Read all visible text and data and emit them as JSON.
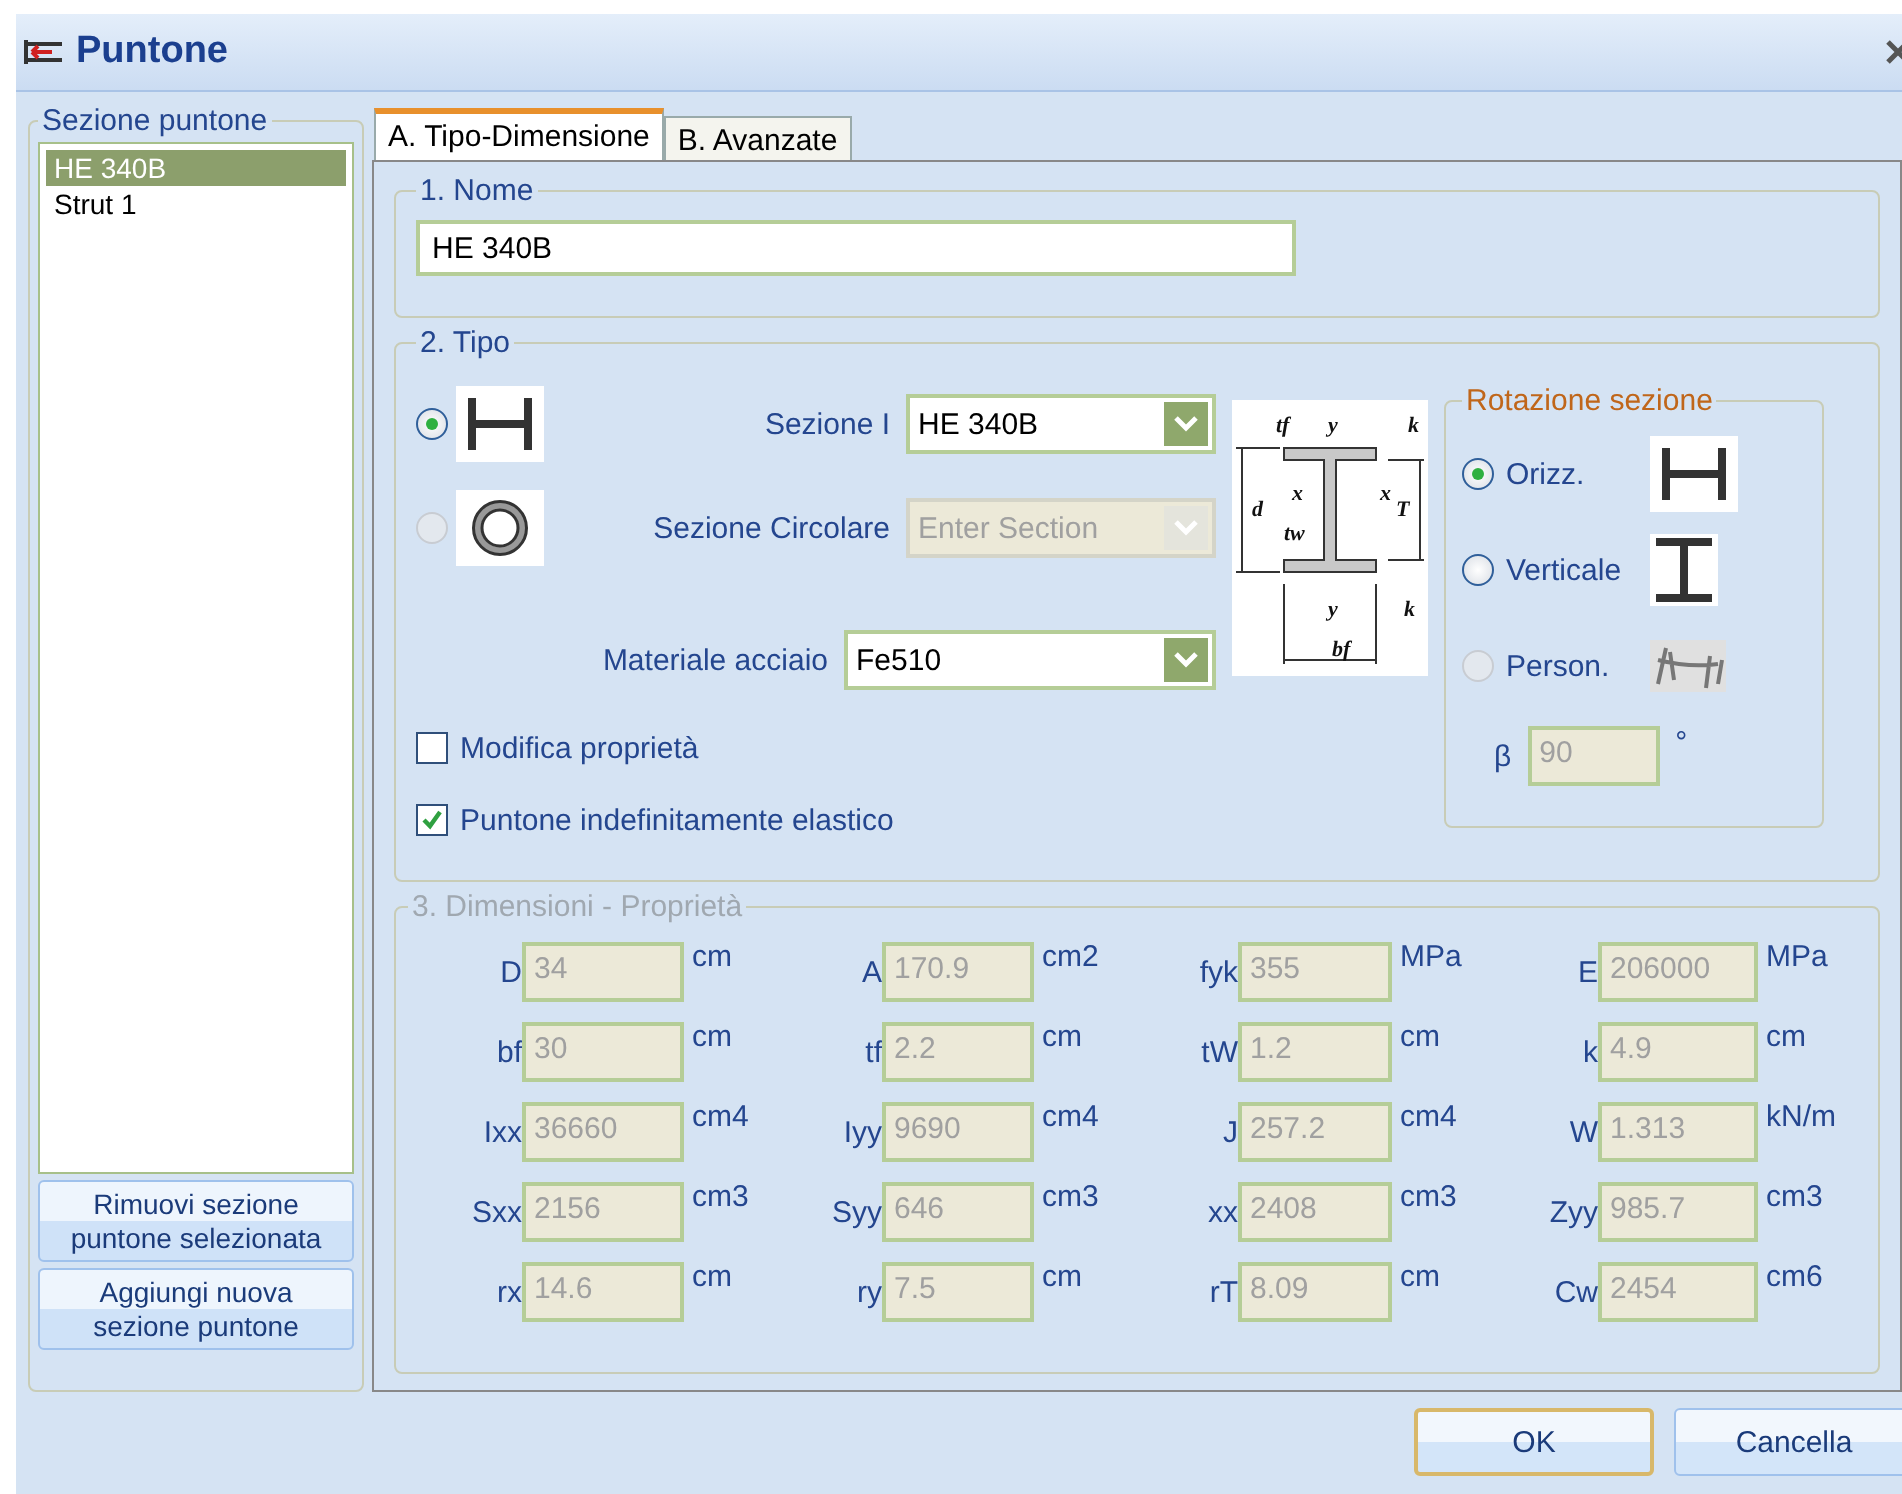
{
  "window": {
    "title": "Puntone"
  },
  "sidebar": {
    "title": "Sezione puntone",
    "items": [
      {
        "label": "HE 340B",
        "selected": true
      },
      {
        "label": "Strut 1",
        "selected": false
      }
    ],
    "buttons": [
      "Rimuovi sezione puntone selezionata",
      "Aggiungi nuova sezione puntone"
    ]
  },
  "tabs": [
    {
      "label": "A. Tipo-Dimensione",
      "selected": true
    },
    {
      "label": "B. Avanzate",
      "selected": false
    }
  ],
  "nome": {
    "title": "1. Nome",
    "value": "HE 340B"
  },
  "tipo": {
    "title": "2. Tipo",
    "options": [
      {
        "kind": "i_section",
        "selected": true,
        "label": "Sezione I",
        "value": "HE 340B",
        "disabled": false
      },
      {
        "kind": "circular",
        "selected": false,
        "label": "Sezione Circolare",
        "placeholder": "Enter Section",
        "disabled": true
      }
    ],
    "material": {
      "label": "Materiale acciaio",
      "value": "Fe510"
    },
    "checkboxes": [
      {
        "label": "Modifica proprietà",
        "checked": false
      },
      {
        "label": "Puntone indefinitamente elastico",
        "checked": true
      }
    ],
    "diagram_labels": [
      "tf",
      "y",
      "k",
      "d",
      "x",
      "x",
      "T",
      "tw",
      "y",
      "k",
      "bf"
    ]
  },
  "rotation": {
    "title": "Rotazione sezione",
    "options": [
      {
        "kind": "horizontal",
        "label": "Orizz.",
        "selected": true,
        "disabled": false
      },
      {
        "kind": "vertical",
        "label": "Verticale",
        "selected": false,
        "disabled": false
      },
      {
        "kind": "custom",
        "label": "Person.",
        "selected": false,
        "disabled": true
      }
    ],
    "beta": {
      "label": "β",
      "value": "90",
      "unit": "°",
      "disabled": true
    }
  },
  "dimensions": {
    "title": "3. Dimensioni - Proprietà",
    "disabled": true,
    "fields": [
      {
        "label": "D",
        "value": "34",
        "unit": "cm"
      },
      {
        "label": "A",
        "value": "170.9",
        "unit": "cm2"
      },
      {
        "label": "fyk",
        "value": "355",
        "unit": "MPa"
      },
      {
        "label": "E",
        "value": "206000",
        "unit": "MPa"
      },
      {
        "label": "bf",
        "value": "30",
        "unit": "cm"
      },
      {
        "label": "tf",
        "value": "2.2",
        "unit": "cm"
      },
      {
        "label": "tW",
        "value": "1.2",
        "unit": "cm"
      },
      {
        "label": "k",
        "value": "4.9",
        "unit": "cm"
      },
      {
        "label": "Ixx",
        "value": "36660",
        "unit": "cm4"
      },
      {
        "label": "Iyy",
        "value": "9690",
        "unit": "cm4"
      },
      {
        "label": "J",
        "value": "257.2",
        "unit": "cm4"
      },
      {
        "label": "W",
        "value": "1.313",
        "unit": "kN/m"
      },
      {
        "label": "Sxx",
        "value": "2156",
        "unit": "cm3"
      },
      {
        "label": "Syy",
        "value": "646",
        "unit": "cm3"
      },
      {
        "label": "xx",
        "value": "2408",
        "unit": "cm3"
      },
      {
        "label": "Zyy",
        "value": "985.7",
        "unit": "cm3"
      },
      {
        "label": "rx",
        "value": "14.6",
        "unit": "cm"
      },
      {
        "label": "ry",
        "value": "7.5",
        "unit": "cm"
      },
      {
        "label": "rT",
        "value": "8.09",
        "unit": "cm"
      },
      {
        "label": "Cw",
        "value": "2454",
        "unit": "cm6"
      }
    ]
  },
  "buttons": [
    {
      "label": "OK",
      "default": true
    },
    {
      "label": "Cancella",
      "default": false
    }
  ]
}
